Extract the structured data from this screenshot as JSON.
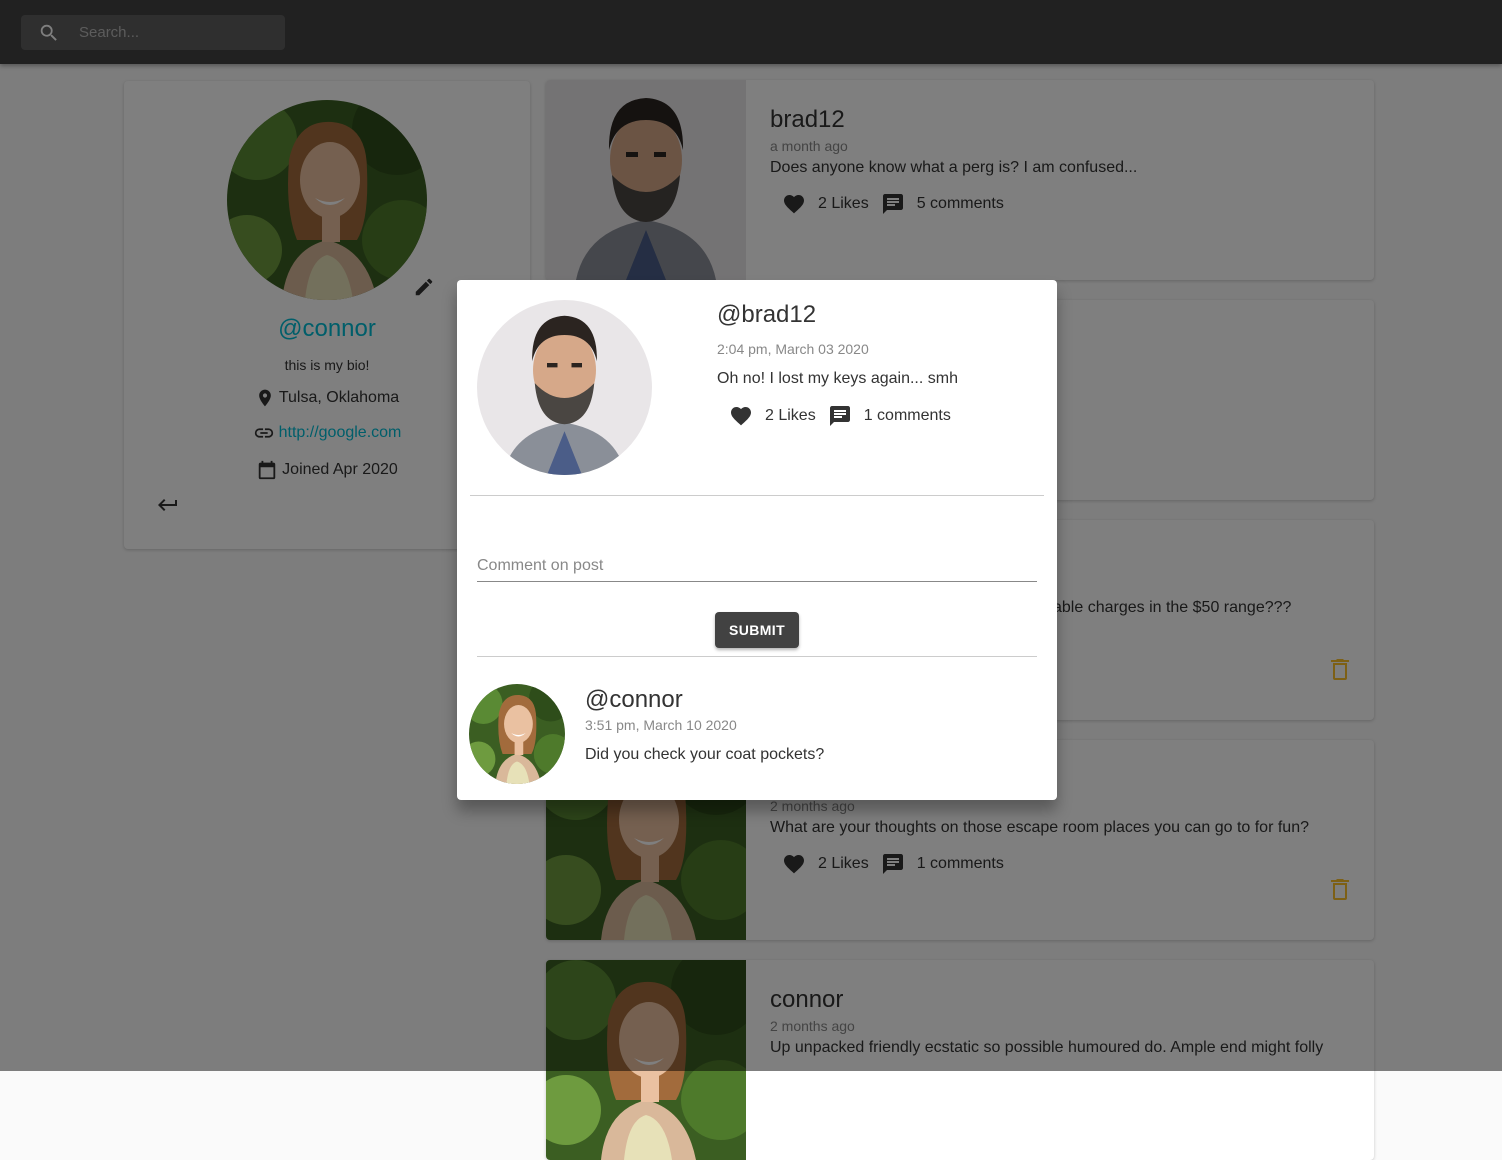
{
  "search": {
    "placeholder": "Search..."
  },
  "profile": {
    "handle": "@connor",
    "bio": "this is my bio!",
    "location": "Tulsa, Oklahoma",
    "website": "http://google.com",
    "joined": "Joined Apr 2020"
  },
  "posts": [
    {
      "user": "brad12",
      "time": "a month ago",
      "body": "Does anyone know what a perg is? I am confused...",
      "likes": "2 Likes",
      "comments": "5 comments"
    },
    {
      "user": "",
      "time": "",
      "body": "",
      "likes": "",
      "comments": ""
    },
    {
      "user": "",
      "time": "",
      "body": "able charges in the $50 range???",
      "likes": "",
      "comments": ""
    },
    {
      "user": "",
      "time": "2 months ago",
      "body": "What are your thoughts on those escape room places you can go to for fun?",
      "likes": "2 Likes",
      "comments": "1 comments"
    },
    {
      "user": "connor",
      "time": "2 months ago",
      "body": "Up unpacked friendly ecstatic so possible humoured do. Ample end might folly",
      "likes": "",
      "comments": ""
    }
  ],
  "dialog": {
    "user": "@brad12",
    "time": "2:04 pm, March 03 2020",
    "body": "Oh no! I lost my keys again... smh",
    "likes": "2 Likes",
    "comments": "1 comments",
    "comment_placeholder": "Comment on post",
    "submit_label": "SUBMIT",
    "comment": {
      "user": "@connor",
      "time": "3:51 pm, March 10 2020",
      "body": "Did you check your coat pockets?"
    }
  },
  "colors": {
    "accent": "#00bcd4",
    "appbar": "#424242",
    "delete": "#fbc02d"
  },
  "icons": [
    "search-icon",
    "edit-icon",
    "location-icon",
    "link-icon",
    "calendar-icon",
    "logout-icon",
    "heart-icon",
    "chat-icon",
    "delete-icon"
  ]
}
